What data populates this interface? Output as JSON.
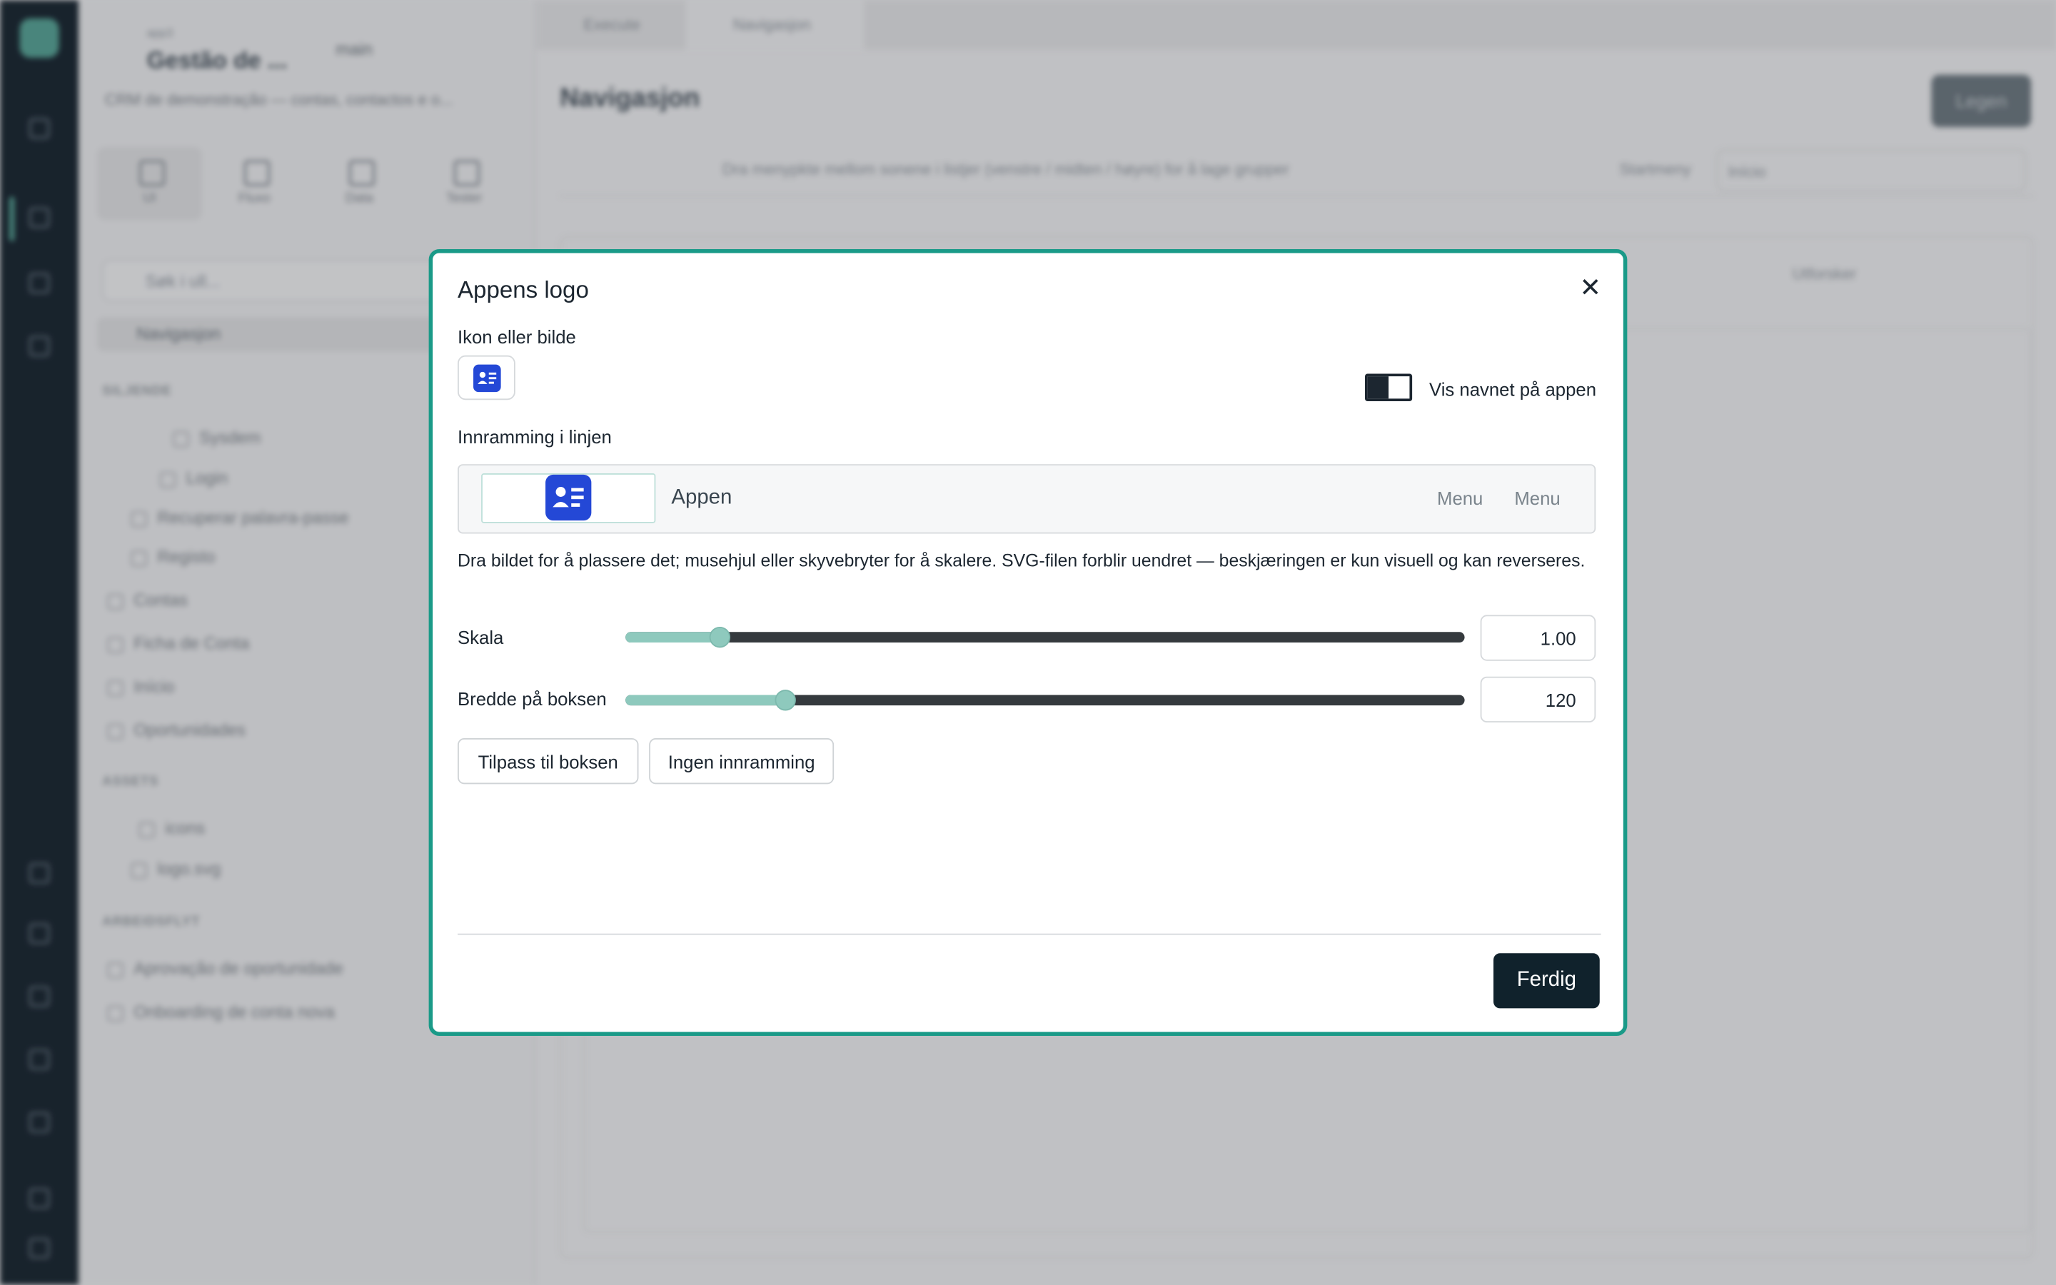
{
  "background": {
    "project": {
      "small_label": "app3",
      "title": "Gestão de ...",
      "branch": "main",
      "description": "CRM de demonstração — contas, contactos e o..."
    },
    "sidebar_tabs": [
      "UI",
      "Fluxo",
      "Data",
      "Tester"
    ],
    "search_placeholder": "Søk i ull...",
    "nav_selected": "Navigasjon",
    "sections": {
      "pages": "SILJENDE",
      "assets": "ASSETS",
      "workflows": "ARBEIDSFLYT"
    },
    "tree": [
      "Sysdem",
      "Login",
      "Recuperar palavra-passe",
      "Registo",
      "Contas",
      "Ficha de Conta",
      "Início",
      "Oportunidades"
    ],
    "assets": [
      "icons",
      "logo.svg"
    ],
    "workflows": [
      "Aprovação de oportunidade",
      "Onboarding de conta nova"
    ],
    "tabs": [
      "Execute",
      "Navigasjon"
    ],
    "page_title": "Navigasjon",
    "publish_label": "Legen",
    "toolbar_hint": "Dra menypkte mellom sonene i listjer (venstre / midten / høyre) for å lage grupper",
    "startside_label": "Startmeny",
    "startside_value": "Início",
    "utfordrer": "Utforsker"
  },
  "modal": {
    "title": "Appens logo",
    "close_icon": "close-icon",
    "icon_label": "Ikon eller bilde",
    "icon_name": "id-card-icon",
    "icon_color": "#2448d6",
    "toggle_label": "Vis navnet på appen",
    "toggle_on": false,
    "framing_label": "Innramming i linjen",
    "preview": {
      "app_name": "Appen",
      "menu_items": [
        "Menu",
        "Menu"
      ]
    },
    "description": "Dra bildet for å plassere det; musehjul eller skyvebryter for å skalere. SVG-filen forblir uendret — beskjæringen er kun visuell og kan reverseres.",
    "scale": {
      "label": "Skala",
      "value": "1.00",
      "fraction": 0.113
    },
    "box_width": {
      "label": "Bredde på boksen",
      "value": "120",
      "fraction": 0.19
    },
    "fit_button": "Tilpass til boksen",
    "no_frame_button": "Ingen innramming",
    "done_button": "Ferdig",
    "accent_color": "#1a9a88"
  }
}
